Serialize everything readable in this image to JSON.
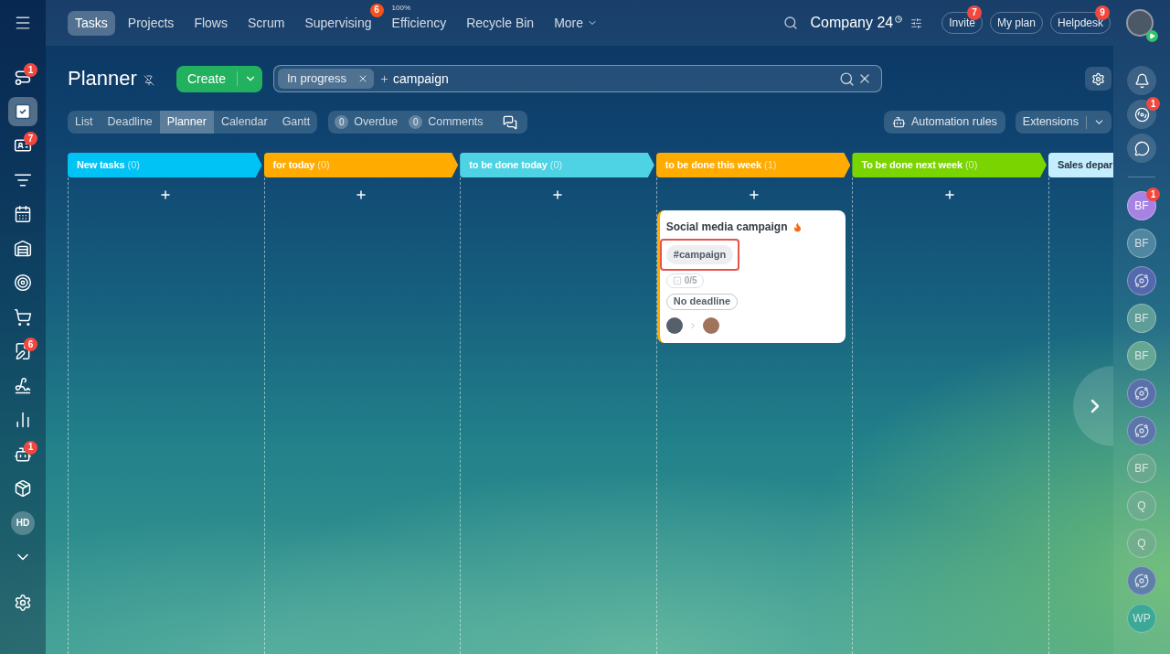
{
  "left_sidebar": {
    "items": [
      {
        "kind": "icon",
        "selected": false,
        "badge": "1"
      },
      {
        "kind": "icon",
        "selected": true
      },
      {
        "kind": "icon",
        "selected": false,
        "badge": "7"
      },
      {
        "kind": "icon",
        "selected": false
      },
      {
        "kind": "icon",
        "selected": false
      },
      {
        "kind": "icon",
        "selected": false
      },
      {
        "kind": "icon",
        "selected": false
      },
      {
        "kind": "icon",
        "selected": false
      },
      {
        "kind": "icon",
        "selected": false,
        "badge": "6"
      },
      {
        "kind": "icon",
        "selected": false
      },
      {
        "kind": "icon",
        "selected": false
      },
      {
        "kind": "icon",
        "selected": false,
        "badge": "1"
      },
      {
        "kind": "icon",
        "selected": false
      },
      {
        "kind": "initials",
        "selected": false,
        "label": "HD"
      },
      {
        "kind": "icon",
        "selected": false
      },
      {
        "kind": "icon",
        "selected": false
      }
    ]
  },
  "top_bar": {
    "tabs": [
      {
        "label": "Tasks",
        "kind": "tab",
        "selected": true
      },
      {
        "label": "Projects",
        "kind": "tab",
        "selected": false
      },
      {
        "label": "Flows",
        "kind": "tab",
        "selected": false
      },
      {
        "label": "Scrum",
        "kind": "tab",
        "selected": false
      },
      {
        "label": "Supervising",
        "kind": "tab",
        "selected": false,
        "badge": "6"
      },
      {
        "label": "Efficiency",
        "kind": "tab",
        "selected": false,
        "note": "100%"
      },
      {
        "label": "Recycle Bin",
        "kind": "tab",
        "selected": false
      },
      {
        "label": "More",
        "kind": "dropdown",
        "selected": false
      }
    ],
    "company": "Company 24",
    "buttons": [
      {
        "label": "Invite",
        "badge": "7"
      },
      {
        "label": "My plan"
      },
      {
        "label": "Helpdesk",
        "badge": "9"
      }
    ]
  },
  "header": {
    "title": "Planner",
    "create": "Create",
    "filter_chips": [
      "In progress"
    ],
    "search_value": "campaign"
  },
  "views": [
    {
      "label": "List",
      "selected": false
    },
    {
      "label": "Deadline",
      "selected": false
    },
    {
      "label": "Planner",
      "selected": true
    },
    {
      "label": "Calendar",
      "selected": false
    },
    {
      "label": "Gantt",
      "selected": false
    }
  ],
  "counters": [
    {
      "count": "0",
      "label": "Overdue"
    },
    {
      "count": "0",
      "label": "Comments"
    }
  ],
  "toolbar": {
    "automation": "Automation rules",
    "extensions": "Extensions"
  },
  "columns": [
    {
      "title": "New tasks",
      "count": "(0)",
      "color": "#00c3f5"
    },
    {
      "title": "for today",
      "count": "(0)",
      "color": "#ffab00"
    },
    {
      "title": "to be done today",
      "count": "(0)",
      "color": "#4dd3e3"
    },
    {
      "title": "to be done this week",
      "count": "(1)",
      "color": "#ffab00",
      "cards": [
        {
          "title": "Social media campaign",
          "hot": true,
          "tags": [
            {
              "label": "#campaign",
              "highlighted": true
            }
          ],
          "checklist": "0/5",
          "deadline": "No deadline"
        }
      ]
    },
    {
      "title": "To be done next week",
      "count": "(0)",
      "color": "#7ad400"
    },
    {
      "title": "Sales depar",
      "color": "#c4eefe"
    }
  ],
  "right_panel": {
    "tools": [
      {
        "kind": "icon"
      },
      {
        "kind": "icon",
        "badge": "1"
      },
      {
        "kind": "icon"
      }
    ],
    "chats": [
      {
        "kind": "initials",
        "label": "BF",
        "color": "#a683e3",
        "dimmed": false,
        "badge": "1"
      },
      {
        "kind": "initials",
        "label": "BF",
        "color": "#4f86a0",
        "dimmed": true
      },
      {
        "kind": "group",
        "color": "#5468ad",
        "dimmed": true
      },
      {
        "kind": "initials",
        "label": "BF",
        "color": "#5f9e98",
        "dimmed": true
      },
      {
        "kind": "initials",
        "label": "BF",
        "color": "#66a695",
        "dimmed": true
      },
      {
        "kind": "group",
        "color": "#5a70ab",
        "dimmed": true
      },
      {
        "kind": "group",
        "color": "#5c75aa",
        "dimmed": true
      },
      {
        "kind": "initials",
        "label": "BF",
        "color": "#6aa890",
        "dimmed": true
      },
      {
        "kind": "initials",
        "label": "Q",
        "color": "#6dac8e",
        "dimmed": true
      },
      {
        "kind": "initials",
        "label": "Q",
        "color": "#70ae8c",
        "dimmed": true
      },
      {
        "kind": "group",
        "color": "#5f7fa9",
        "dimmed": true
      },
      {
        "kind": "initials",
        "label": "WP",
        "color": "#3ea896",
        "dimmed": true
      }
    ]
  }
}
